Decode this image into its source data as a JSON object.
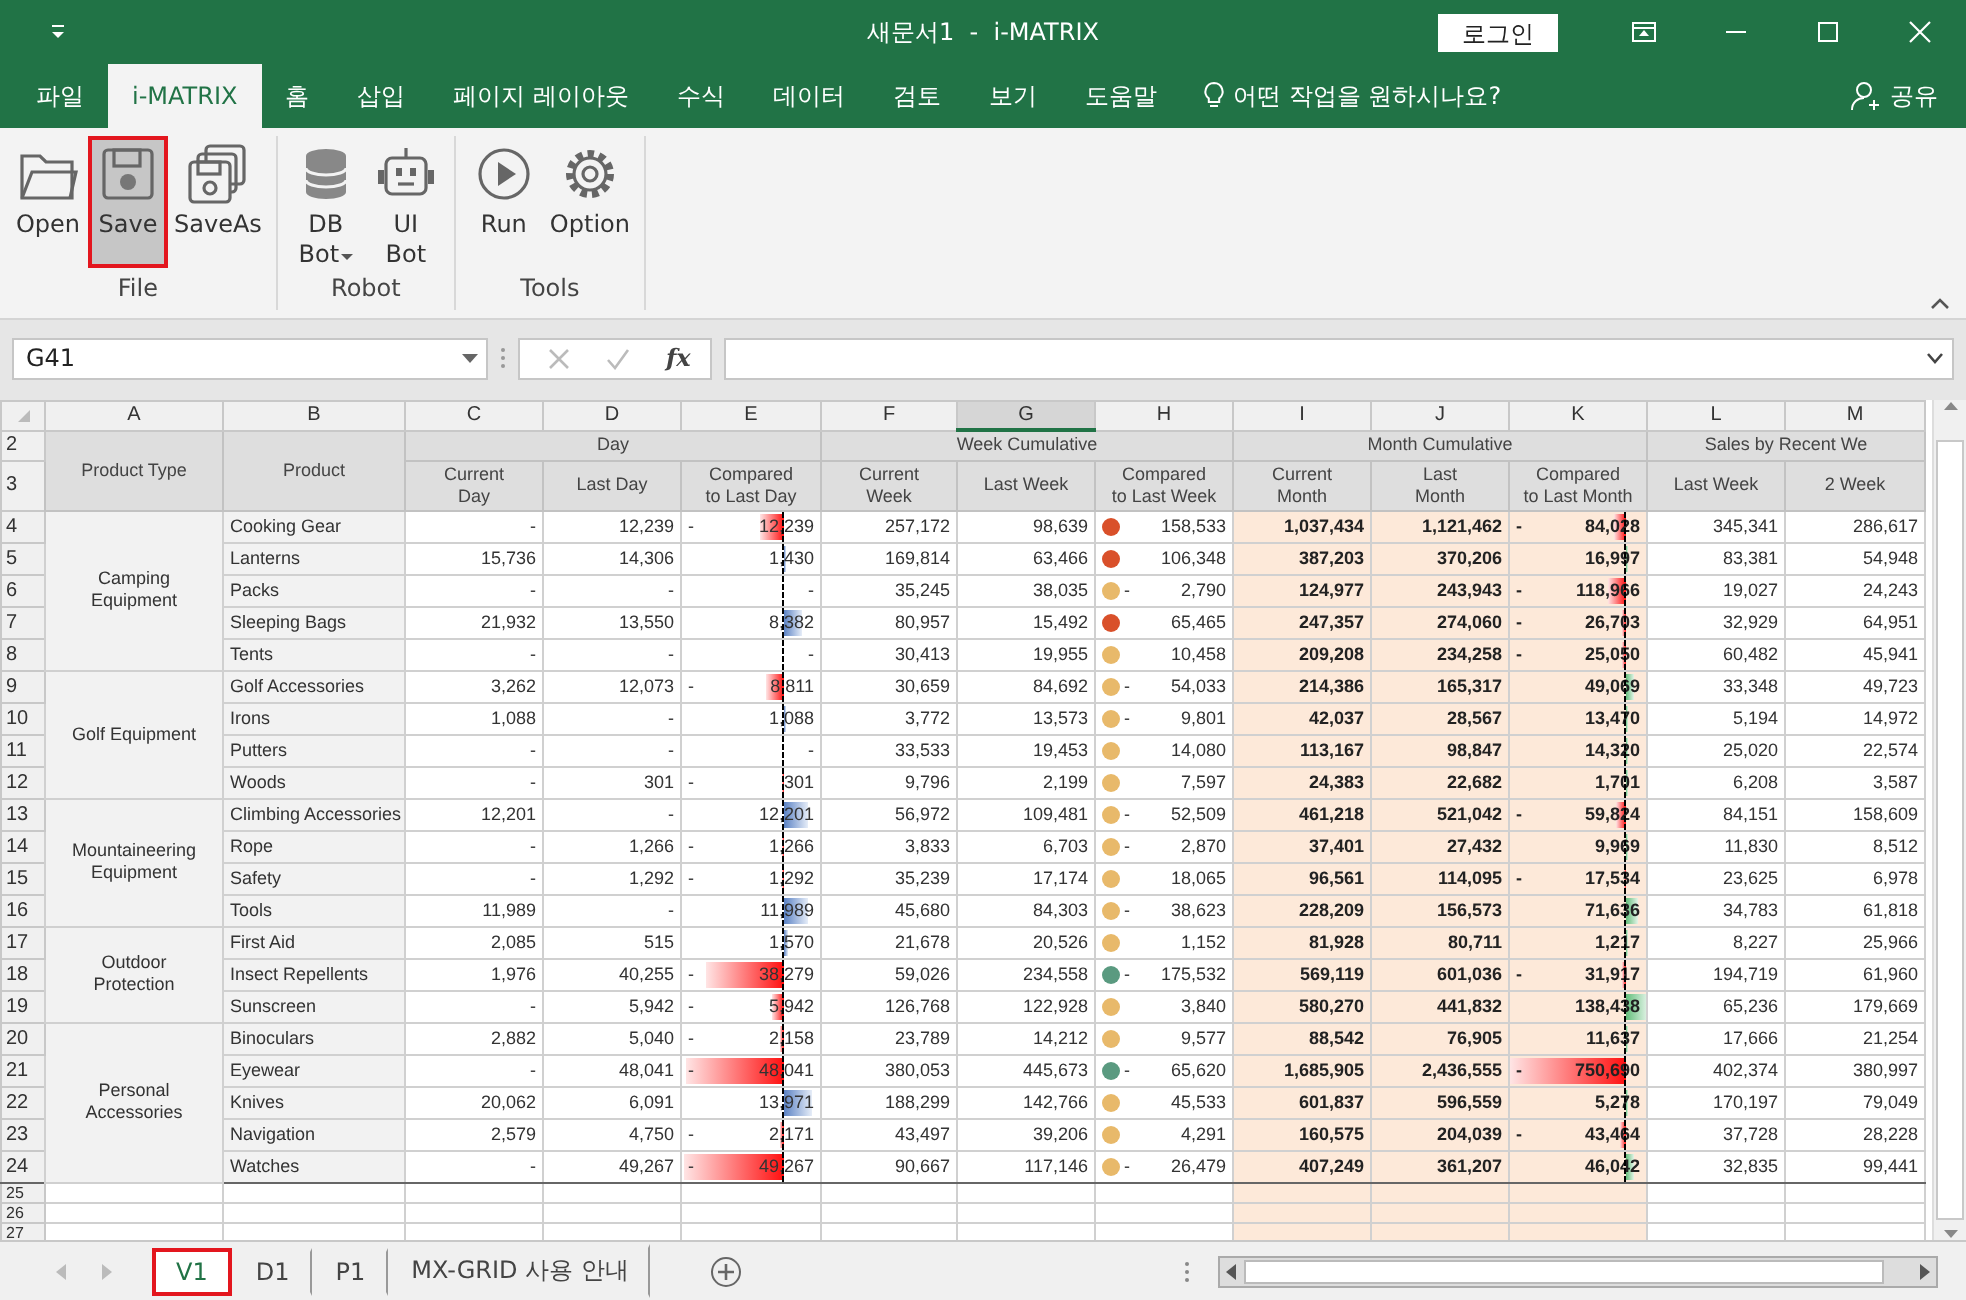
{
  "window": {
    "title": "새문서1  -  i-MATRIX",
    "login_button": "로그인"
  },
  "menu_tabs": [
    {
      "label": "파일",
      "selected": false
    },
    {
      "label": "i-MATRIX",
      "selected": true
    },
    {
      "label": "홈",
      "selected": false
    },
    {
      "label": "삽입",
      "selected": false
    },
    {
      "label": "페이지 레이아웃",
      "selected": false
    },
    {
      "label": "수식",
      "selected": false
    },
    {
      "label": "데이터",
      "selected": false
    },
    {
      "label": "검토",
      "selected": false
    },
    {
      "label": "보기",
      "selected": false
    },
    {
      "label": "도움말",
      "selected": false
    }
  ],
  "tell_me": "어떤 작업을 원하시나요?",
  "share": "공유",
  "ribbon_groups": [
    {
      "label": "File",
      "buttons": [
        {
          "label": "Open",
          "selected": false
        },
        {
          "label": "Save",
          "selected": true
        },
        {
          "label": "SaveAs",
          "selected": false
        }
      ]
    },
    {
      "label": "Robot",
      "buttons": [
        {
          "label": "DB Bot",
          "selected": false,
          "dropdown": true
        },
        {
          "label": "UI Bot",
          "selected": false
        }
      ]
    },
    {
      "label": "Tools",
      "buttons": [
        {
          "label": "Run",
          "selected": false
        },
        {
          "label": "Option",
          "selected": false
        }
      ]
    }
  ],
  "formula_bar": {
    "name_box": "G41",
    "fx": "fx"
  },
  "sheet": {
    "columns": [
      {
        "label": "A",
        "selected": false
      },
      {
        "label": "B",
        "selected": false
      },
      {
        "label": "C",
        "selected": false
      },
      {
        "label": "D",
        "selected": false
      },
      {
        "label": "E",
        "selected": false
      },
      {
        "label": "F",
        "selected": false
      },
      {
        "label": "G",
        "selected": true
      },
      {
        "label": "H",
        "selected": false
      },
      {
        "label": "I",
        "selected": false
      },
      {
        "label": "J",
        "selected": false
      },
      {
        "label": "K",
        "selected": false
      },
      {
        "label": "L",
        "selected": false
      },
      {
        "label": "M",
        "selected": false
      }
    ],
    "header_rows": [
      "2",
      "3"
    ],
    "product_type_header": "Product Type",
    "product_header": "Product",
    "column_groups": [
      {
        "label": "Day",
        "columns": [
          "Current\nDay",
          "Last Day",
          "Compared\nto Last Day"
        ]
      },
      {
        "label": "Week Cumulative",
        "columns": [
          "Current\nWeek",
          "Last Week",
          "Compared\nto Last Week"
        ]
      },
      {
        "label": "Month Cumulative",
        "columns": [
          "Current\nMonth",
          "Last\nMonth",
          "Compared\nto Last Month"
        ]
      },
      {
        "label": "Sales by Recent We",
        "columns": [
          "Last Week",
          "2 Week"
        ]
      }
    ],
    "groups": [
      {
        "type": "Camping\nEquipment",
        "rows": [
          {
            "row": "4",
            "product": "Cooking Gear",
            "current_day": "-",
            "last_day": "12,239",
            "vs_last_day": {
              "sign": "-",
              "value": "12,239",
              "negative": true
            },
            "current_week": "257,172",
            "last_week": "98,639",
            "vs_last_week": {
              "color": "#d9502a",
              "value": "158,533"
            },
            "current_month": "1,037,434",
            "last_month": "1,121,462",
            "vs_last_month": {
              "sign": "-",
              "value": "84,028",
              "negative": true
            },
            "recent_last_week": "345,341",
            "recent_2_week": "286,617"
          },
          {
            "row": "5",
            "product": "Lanterns",
            "current_day": "15,736",
            "last_day": "14,306",
            "vs_last_day": {
              "value": "1,430",
              "negative": false
            },
            "current_week": "169,814",
            "last_week": "63,466",
            "vs_last_week": {
              "color": "#d9502a",
              "value": "106,348"
            },
            "current_month": "387,203",
            "last_month": "370,206",
            "vs_last_month": {
              "value": "16,997",
              "negative": false
            },
            "recent_last_week": "83,381",
            "recent_2_week": "54,948"
          },
          {
            "row": "6",
            "product": "Packs",
            "current_day": "-",
            "last_day": "-",
            "vs_last_day": {
              "value": "-"
            },
            "current_week": "35,245",
            "last_week": "38,035",
            "vs_last_week": {
              "color": "#e8b96a",
              "sign": "-",
              "value": "2,790"
            },
            "current_month": "124,977",
            "last_month": "243,943",
            "vs_last_month": {
              "sign": "-",
              "value": "118,966",
              "negative": true
            },
            "recent_last_week": "19,027",
            "recent_2_week": "24,243"
          },
          {
            "row": "7",
            "product": "Sleeping Bags",
            "current_day": "21,932",
            "last_day": "13,550",
            "vs_last_day": {
              "value": "8,382",
              "negative": false
            },
            "current_week": "80,957",
            "last_week": "15,492",
            "vs_last_week": {
              "color": "#d9502a",
              "value": "65,465"
            },
            "current_month": "247,357",
            "last_month": "274,060",
            "vs_last_month": {
              "sign": "-",
              "value": "26,703",
              "negative": true
            },
            "recent_last_week": "32,929",
            "recent_2_week": "64,951"
          },
          {
            "row": "8",
            "product": "Tents",
            "current_day": "-",
            "last_day": "-",
            "vs_last_day": {
              "value": "-"
            },
            "current_week": "30,413",
            "last_week": "19,955",
            "vs_last_week": {
              "color": "#e8b96a",
              "value": "10,458"
            },
            "current_month": "209,208",
            "last_month": "234,258",
            "vs_last_month": {
              "sign": "-",
              "value": "25,050",
              "negative": true
            },
            "recent_last_week": "60,482",
            "recent_2_week": "45,941"
          }
        ]
      },
      {
        "type": "Golf Equipment",
        "rows": [
          {
            "row": "9",
            "product": "Golf Accessories",
            "current_day": "3,262",
            "last_day": "12,073",
            "vs_last_day": {
              "sign": "-",
              "value": "8,811",
              "negative": true
            },
            "current_week": "30,659",
            "last_week": "84,692",
            "vs_last_week": {
              "color": "#e8b96a",
              "sign": "-",
              "value": "54,033"
            },
            "current_month": "214,386",
            "last_month": "165,317",
            "vs_last_month": {
              "value": "49,069",
              "negative": false
            },
            "recent_last_week": "33,348",
            "recent_2_week": "49,723"
          },
          {
            "row": "10",
            "product": "Irons",
            "current_day": "1,088",
            "last_day": "-",
            "vs_last_day": {
              "value": "1,088",
              "negative": false
            },
            "current_week": "3,772",
            "last_week": "13,573",
            "vs_last_week": {
              "color": "#e8b96a",
              "sign": "-",
              "value": "9,801"
            },
            "current_month": "42,037",
            "last_month": "28,567",
            "vs_last_month": {
              "value": "13,470",
              "negative": false
            },
            "recent_last_week": "5,194",
            "recent_2_week": "14,972"
          },
          {
            "row": "11",
            "product": "Putters",
            "current_day": "-",
            "last_day": "-",
            "vs_last_day": {
              "value": "-"
            },
            "current_week": "33,533",
            "last_week": "19,453",
            "vs_last_week": {
              "color": "#e8b96a",
              "value": "14,080"
            },
            "current_month": "113,167",
            "last_month": "98,847",
            "vs_last_month": {
              "value": "14,320",
              "negative": false
            },
            "recent_last_week": "25,020",
            "recent_2_week": "22,574"
          },
          {
            "row": "12",
            "product": "Woods",
            "current_day": "-",
            "last_day": "301",
            "vs_last_day": {
              "sign": "-",
              "value": "301",
              "negative": true
            },
            "current_week": "9,796",
            "last_week": "2,199",
            "vs_last_week": {
              "color": "#e8b96a",
              "value": "7,597"
            },
            "current_month": "24,383",
            "last_month": "22,682",
            "vs_last_month": {
              "value": "1,701",
              "negative": false
            },
            "recent_last_week": "6,208",
            "recent_2_week": "3,587"
          }
        ]
      },
      {
        "type": "Mountaineering\nEquipment",
        "rows": [
          {
            "row": "13",
            "product": "Climbing Accessories",
            "current_day": "12,201",
            "last_day": "-",
            "vs_last_day": {
              "value": "12,201",
              "negative": false
            },
            "current_week": "56,972",
            "last_week": "109,481",
            "vs_last_week": {
              "color": "#e8b96a",
              "sign": "-",
              "value": "52,509"
            },
            "current_month": "461,218",
            "last_month": "521,042",
            "vs_last_month": {
              "sign": "-",
              "value": "59,824",
              "negative": true
            },
            "recent_last_week": "84,151",
            "recent_2_week": "158,609"
          },
          {
            "row": "14",
            "product": "Rope",
            "current_day": "-",
            "last_day": "1,266",
            "vs_last_day": {
              "sign": "-",
              "value": "1,266",
              "negative": true
            },
            "current_week": "3,833",
            "last_week": "6,703",
            "vs_last_week": {
              "color": "#e8b96a",
              "sign": "-",
              "value": "2,870"
            },
            "current_month": "37,401",
            "last_month": "27,432",
            "vs_last_month": {
              "value": "9,969",
              "negative": false
            },
            "recent_last_week": "11,830",
            "recent_2_week": "8,512"
          },
          {
            "row": "15",
            "product": "Safety",
            "current_day": "-",
            "last_day": "1,292",
            "vs_last_day": {
              "sign": "-",
              "value": "1,292",
              "negative": true
            },
            "current_week": "35,239",
            "last_week": "17,174",
            "vs_last_week": {
              "color": "#e8b96a",
              "value": "18,065"
            },
            "current_month": "96,561",
            "last_month": "114,095",
            "vs_last_month": {
              "sign": "-",
              "value": "17,534",
              "negative": true
            },
            "recent_last_week": "23,625",
            "recent_2_week": "6,978"
          },
          {
            "row": "16",
            "product": "Tools",
            "current_day": "11,989",
            "last_day": "-",
            "vs_last_day": {
              "value": "11,989",
              "negative": false
            },
            "current_week": "45,680",
            "last_week": "84,303",
            "vs_last_week": {
              "color": "#e8b96a",
              "sign": "-",
              "value": "38,623"
            },
            "current_month": "228,209",
            "last_month": "156,573",
            "vs_last_month": {
              "value": "71,636",
              "negative": false
            },
            "recent_last_week": "34,783",
            "recent_2_week": "61,818"
          }
        ]
      },
      {
        "type": "Outdoor\nProtection",
        "rows": [
          {
            "row": "17",
            "product": "First Aid",
            "current_day": "2,085",
            "last_day": "515",
            "vs_last_day": {
              "value": "1,570",
              "negative": false
            },
            "current_week": "21,678",
            "last_week": "20,526",
            "vs_last_week": {
              "color": "#e8b96a",
              "value": "1,152"
            },
            "current_month": "81,928",
            "last_month": "80,711",
            "vs_last_month": {
              "value": "1,217",
              "negative": false
            },
            "recent_last_week": "8,227",
            "recent_2_week": "25,966"
          },
          {
            "row": "18",
            "product": "Insect Repellents",
            "current_day": "1,976",
            "last_day": "40,255",
            "vs_last_day": {
              "sign": "-",
              "value": "38,279",
              "negative": true
            },
            "current_week": "59,026",
            "last_week": "234,558",
            "vs_last_week": {
              "color": "#5a9a80",
              "sign": "-",
              "value": "175,532"
            },
            "current_month": "569,119",
            "last_month": "601,036",
            "vs_last_month": {
              "sign": "-",
              "value": "31,917",
              "negative": true
            },
            "recent_last_week": "194,719",
            "recent_2_week": "61,960"
          },
          {
            "row": "19",
            "product": "Sunscreen",
            "current_day": "-",
            "last_day": "5,942",
            "vs_last_day": {
              "sign": "-",
              "value": "5,942",
              "negative": true
            },
            "current_week": "126,768",
            "last_week": "122,928",
            "vs_last_week": {
              "color": "#e8b96a",
              "value": "3,840"
            },
            "current_month": "580,270",
            "last_month": "441,832",
            "vs_last_month": {
              "value": "138,438",
              "negative": false
            },
            "recent_last_week": "65,236",
            "recent_2_week": "179,669"
          }
        ]
      },
      {
        "type": "Personal\nAccessories",
        "rows": [
          {
            "row": "20",
            "product": "Binoculars",
            "current_day": "2,882",
            "last_day": "5,040",
            "vs_last_day": {
              "sign": "-",
              "value": "2,158",
              "negative": true
            },
            "current_week": "23,789",
            "last_week": "14,212",
            "vs_last_week": {
              "color": "#e8b96a",
              "value": "9,577"
            },
            "current_month": "88,542",
            "last_month": "76,905",
            "vs_last_month": {
              "value": "11,637",
              "negative": false
            },
            "recent_last_week": "17,666",
            "recent_2_week": "21,254"
          },
          {
            "row": "21",
            "product": "Eyewear",
            "current_day": "-",
            "last_day": "48,041",
            "vs_last_day": {
              "sign": "-",
              "value": "48,041",
              "negative": true
            },
            "current_week": "380,053",
            "last_week": "445,673",
            "vs_last_week": {
              "color": "#5a9a80",
              "sign": "-",
              "value": "65,620"
            },
            "current_month": "1,685,905",
            "last_month": "2,436,555",
            "vs_last_month": {
              "sign": "-",
              "value": "750,690",
              "negative": true
            },
            "recent_last_week": "402,374",
            "recent_2_week": "380,997"
          },
          {
            "row": "22",
            "product": "Knives",
            "current_day": "20,062",
            "last_day": "6,091",
            "vs_last_day": {
              "value": "13,971",
              "negative": false
            },
            "current_week": "188,299",
            "last_week": "142,766",
            "vs_last_week": {
              "color": "#e8b96a",
              "value": "45,533"
            },
            "current_month": "601,837",
            "last_month": "596,559",
            "vs_last_month": {
              "value": "5,278",
              "negative": false
            },
            "recent_last_week": "170,197",
            "recent_2_week": "79,049"
          },
          {
            "row": "23",
            "product": "Navigation",
            "current_day": "2,579",
            "last_day": "4,750",
            "vs_last_day": {
              "sign": "-",
              "value": "2,171",
              "negative": true
            },
            "current_week": "43,497",
            "last_week": "39,206",
            "vs_last_week": {
              "color": "#e8b96a",
              "value": "4,291"
            },
            "current_month": "160,575",
            "last_month": "204,039",
            "vs_last_month": {
              "sign": "-",
              "value": "43,464",
              "negative": true
            },
            "recent_last_week": "37,728",
            "recent_2_week": "28,228"
          },
          {
            "row": "24",
            "product": "Watches",
            "current_day": "-",
            "last_day": "49,267",
            "vs_last_day": {
              "sign": "-",
              "value": "49,267",
              "negative": true
            },
            "current_week": "90,667",
            "last_week": "117,146",
            "vs_last_week": {
              "color": "#e8b96a",
              "sign": "-",
              "value": "26,479"
            },
            "current_month": "407,249",
            "last_month": "361,207",
            "vs_last_month": {
              "value": "46,042",
              "negative": false
            },
            "recent_last_week": "32,835",
            "recent_2_week": "99,441"
          }
        ]
      }
    ],
    "empty_rows": [
      "25",
      "26",
      "27"
    ]
  },
  "sheet_tabs": [
    {
      "label": "V1",
      "selected": true
    },
    {
      "label": "D1",
      "selected": false
    },
    {
      "label": "P1",
      "selected": false
    },
    {
      "label": "MX-GRID 사용 안내",
      "selected": false
    }
  ]
}
